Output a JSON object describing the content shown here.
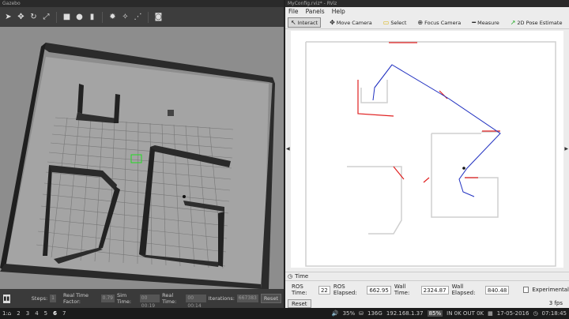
{
  "gazebo": {
    "title": "Gazebo",
    "toolbar": [
      "pointer-icon",
      "translate-icon",
      "rotate-icon",
      "scale-icon",
      "box-icon",
      "sphere-icon",
      "cylinder-icon",
      "sun-icon",
      "spotlight-icon",
      "dirlight-icon",
      "screenshot-icon"
    ],
    "bottom": {
      "pause": "▮▮",
      "steps_label": "Steps:",
      "steps_value": "1",
      "real_time_factor_label": "Real Time Factor:",
      "real_time_factor": "0.79",
      "sim_time_label": "Sim Time:",
      "sim_time": "00 00:19",
      "real_time_label": "Real Time:",
      "real_time": "00 00:14",
      "iterations_label": "Iterations:",
      "iterations": "667383",
      "reset": "Reset"
    }
  },
  "rviz": {
    "title": "MyConfig.rviz* - RViz",
    "menu": [
      "File",
      "Panels",
      "Help"
    ],
    "tools": [
      {
        "label": "Interact",
        "icon": "cursor-icon"
      },
      {
        "label": "Move Camera",
        "icon": "move-camera-icon"
      },
      {
        "label": "Select",
        "icon": "select-icon"
      },
      {
        "label": "Focus Camera",
        "icon": "focus-camera-icon"
      },
      {
        "label": "Measure",
        "icon": "ruler-icon"
      },
      {
        "label": "2D Pose Estimate",
        "icon": "pose-arrow-icon"
      }
    ],
    "time": {
      "header": "Time",
      "ros_time_label": "ROS Time:",
      "ros_time": "22",
      "ros_elapsed_label": "ROS Elapsed:",
      "ros_elapsed": "662.95",
      "wall_time_label": "Wall Time:",
      "wall_time": "2324.87",
      "wall_elapsed_label": "Wall Elapsed:",
      "wall_elapsed": "840.48",
      "experimental": "Experimental",
      "reset": "Reset",
      "fps": "3 fps"
    }
  },
  "taskbar": {
    "workspaces": [
      "1:⌂",
      "2",
      "3",
      "4",
      "5",
      "6",
      "7"
    ],
    "current": "6",
    "volume": "35%",
    "disk": "136G",
    "ip": "192.168.1.37",
    "battery": "85%",
    "net": "IN 0K OUT 0K",
    "date": "17-05-2016",
    "time": "07:18:45"
  },
  "colors": {
    "laser": "#e02020",
    "path": "#2030c0",
    "map_wall": "#cfcfcf"
  }
}
